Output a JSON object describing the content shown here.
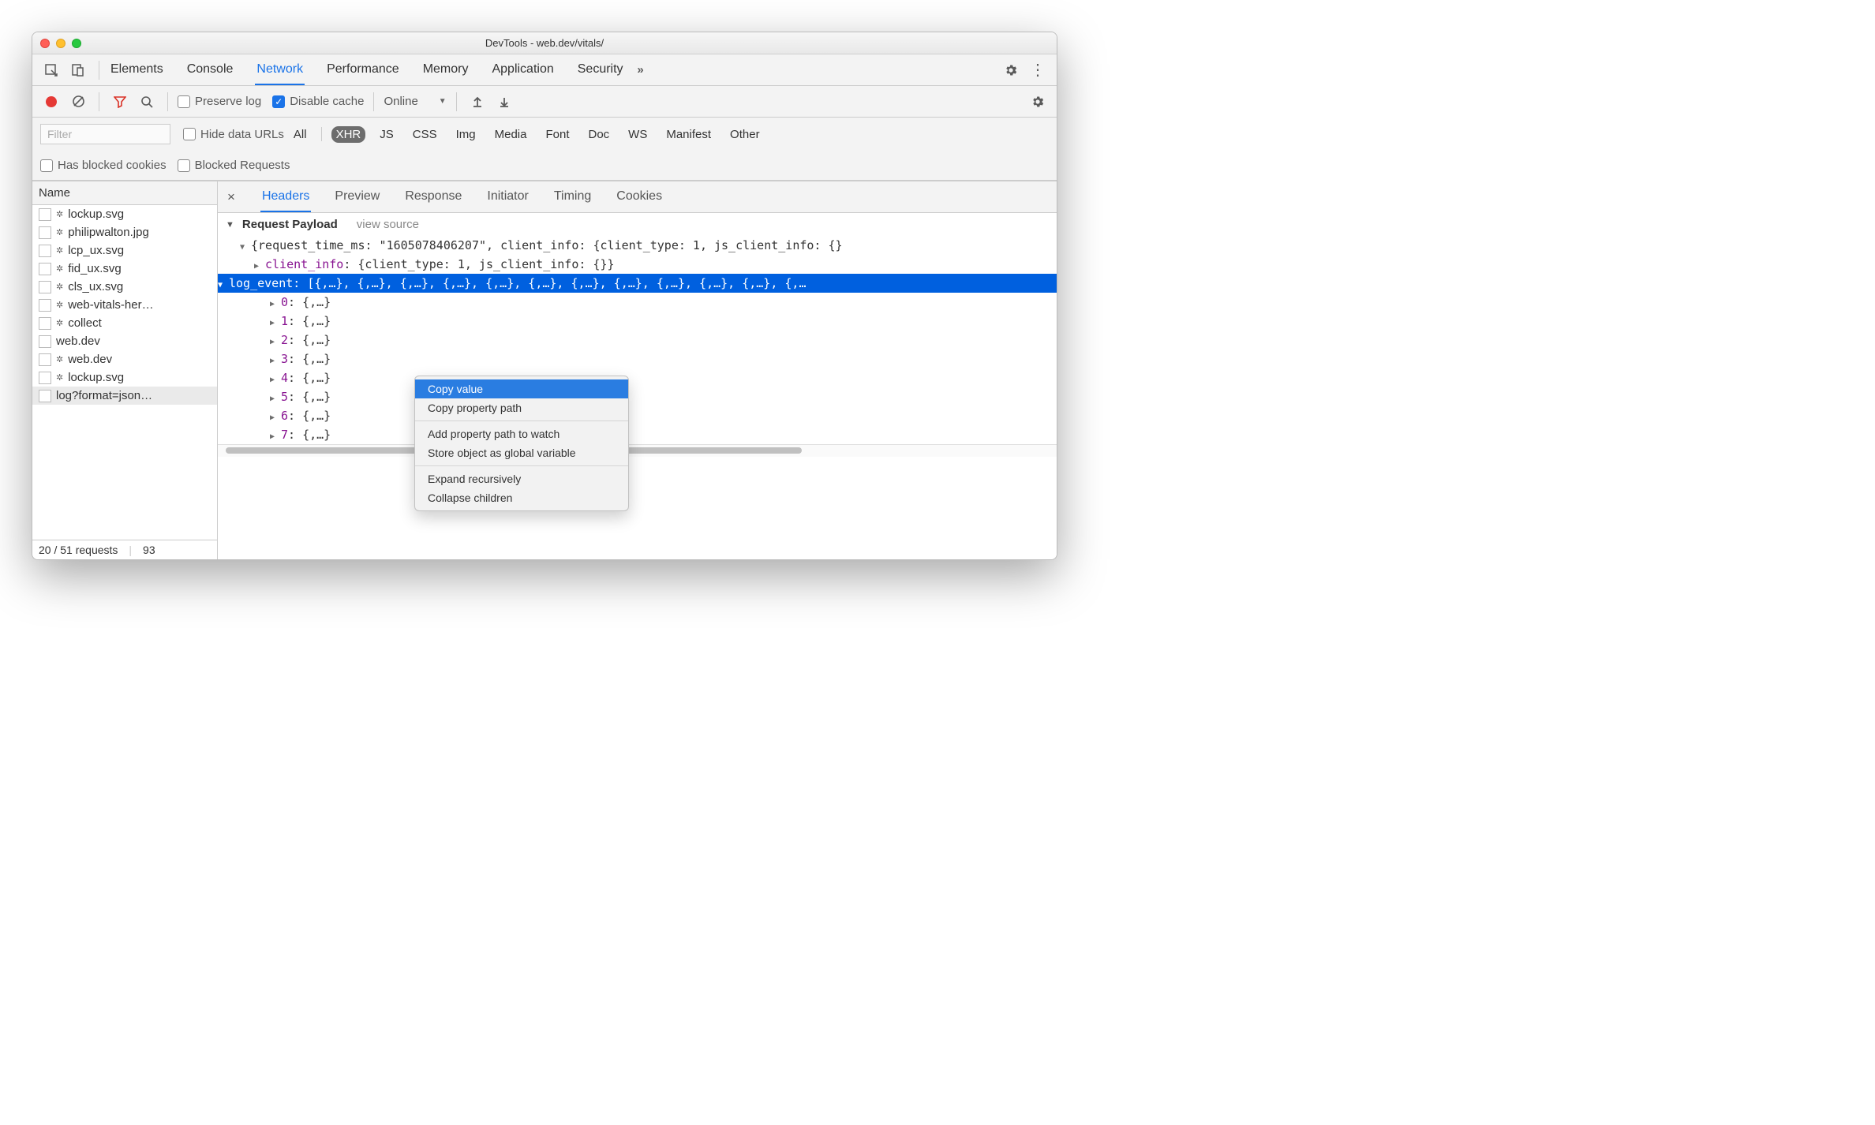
{
  "window": {
    "title": "DevTools - web.dev/vitals/"
  },
  "main_tabs": [
    "Elements",
    "Console",
    "Network",
    "Performance",
    "Memory",
    "Application",
    "Security"
  ],
  "main_tab_active": "Network",
  "net_toolbar": {
    "preserve_log": "Preserve log",
    "disable_cache": "Disable cache",
    "throttling": "Online"
  },
  "filter": {
    "placeholder": "Filter",
    "hide_data_urls": "Hide data URLs",
    "types": [
      "All",
      "XHR",
      "JS",
      "CSS",
      "Img",
      "Media",
      "Font",
      "Doc",
      "WS",
      "Manifest",
      "Other"
    ],
    "type_active": "XHR",
    "has_blocked_cookies": "Has blocked cookies",
    "blocked_requests": "Blocked Requests"
  },
  "left": {
    "header": "Name",
    "items": [
      {
        "name": "lockup.svg",
        "gear": true
      },
      {
        "name": "philipwalton.jpg",
        "gear": true
      },
      {
        "name": "lcp_ux.svg",
        "gear": true
      },
      {
        "name": "fid_ux.svg",
        "gear": true
      },
      {
        "name": "cls_ux.svg",
        "gear": true
      },
      {
        "name": "web-vitals-her…",
        "gear": true
      },
      {
        "name": "collect",
        "gear": true
      },
      {
        "name": "web.dev",
        "gear": false
      },
      {
        "name": "web.dev",
        "gear": true
      },
      {
        "name": "lockup.svg",
        "gear": true
      },
      {
        "name": "log?format=json…",
        "gear": false,
        "selected": true
      }
    ],
    "status_requests": "20 / 51 requests",
    "status_extra": "93"
  },
  "detail_tabs": [
    "Headers",
    "Preview",
    "Response",
    "Initiator",
    "Timing",
    "Cookies"
  ],
  "detail_tab_active": "Headers",
  "payload": {
    "heading": "Request Payload",
    "view_source": "view source",
    "root": "{request_time_ms: \"1605078406207\", client_info: {client_type: 1, js_client_info: {}",
    "client_info_key": "client_info",
    "client_info_val": ": {client_type: 1, js_client_info: {}}",
    "log_event_key": "log_event",
    "log_event_preview": ": [{,…}, {,…}, {,…}, {,…}, {,…}, {,…}, {,…}, {,…}, {,…}, {,…}, {,…}, {,…",
    "items": [
      {
        "idx": "0",
        "val": ": {,…}"
      },
      {
        "idx": "1",
        "val": ": {,…}"
      },
      {
        "idx": "2",
        "val": ": {,…}"
      },
      {
        "idx": "3",
        "val": ": {,…}"
      },
      {
        "idx": "4",
        "val": ": {,…}"
      },
      {
        "idx": "5",
        "val": ": {,…}"
      },
      {
        "idx": "6",
        "val": ": {,…}"
      },
      {
        "idx": "7",
        "val": ": {,…}"
      }
    ]
  },
  "context_menu": {
    "groups": [
      [
        "Copy value",
        "Copy property path"
      ],
      [
        "Add property path to watch",
        "Store object as global variable"
      ],
      [
        "Expand recursively",
        "Collapse children"
      ]
    ],
    "active": "Copy value"
  }
}
